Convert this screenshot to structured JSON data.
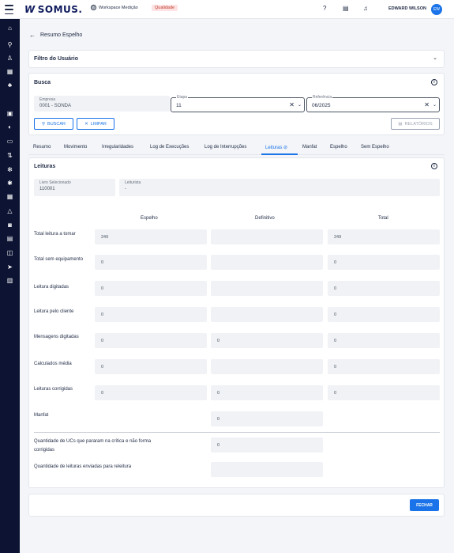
{
  "header": {
    "logo": "SOMUS.",
    "workspace": "Workspace Medição",
    "env_badge": "Qualidade",
    "user": "EDWARD WILSON",
    "avatar_initials": "EW"
  },
  "page": {
    "title": "Resumo Espelho"
  },
  "filtro": {
    "title": "Filtro do Usuário"
  },
  "busca": {
    "title": "Busca",
    "empresa": {
      "label": "Empresa",
      "value": "0001 - SONDA"
    },
    "etapa": {
      "label": "Etapa",
      "value": "11"
    },
    "referencia": {
      "label": "Referência",
      "value": "06/2025"
    },
    "buscar_label": "BUSCAR",
    "limpar_label": "LIMPAR",
    "relatorios_label": "RELATÓRIOS"
  },
  "tabs": [
    "Resumo",
    "Movimento",
    "Irregularidades",
    "Log de Execuções",
    "Log de Interrupções",
    "Leituras ⊘",
    "Manfat",
    "Espelho",
    "Sem Espelho"
  ],
  "leituras": {
    "title": "Leituras",
    "livro": {
      "label": "Livro Selecionado",
      "value": "110001"
    },
    "leiturista": {
      "label": "Leiturista",
      "value": "-"
    },
    "columns": [
      "Espelho",
      "Definitivo",
      "Total"
    ],
    "rows": [
      {
        "label": "Total leitura a tomar",
        "espelho": "249",
        "definitivo": "",
        "total": "249"
      },
      {
        "label": "Total sem equipamento",
        "espelho": "0",
        "definitivo": "",
        "total": "0"
      },
      {
        "label": "Leitura digitadas",
        "espelho": "0",
        "definitivo": "",
        "total": "0"
      },
      {
        "label": "Leitura pelo cliente",
        "espelho": "0",
        "definitivo": "",
        "total": "0"
      },
      {
        "label": "Mensagens digitadas",
        "espelho": "0",
        "definitivo": "0",
        "total": "0"
      },
      {
        "label": "Calculados média",
        "espelho": "0",
        "definitivo": "",
        "total": "0"
      },
      {
        "label": "Leituras corrigidas",
        "espelho": "0",
        "definitivo": "0",
        "total": "0"
      },
      {
        "label": "Manfat",
        "definitivo": "0"
      }
    ],
    "extra": [
      {
        "label": "Quantidade de UCs que pararam na crítica e não forma corrigidas",
        "value": "0"
      },
      {
        "label": "Quantidade de leituras enviadas para releitura",
        "value": ""
      }
    ]
  },
  "footer": {
    "fechar_label": "FECHAR"
  },
  "colors": {
    "accent": "#1a73e8",
    "sidebar": "#0d1433"
  }
}
